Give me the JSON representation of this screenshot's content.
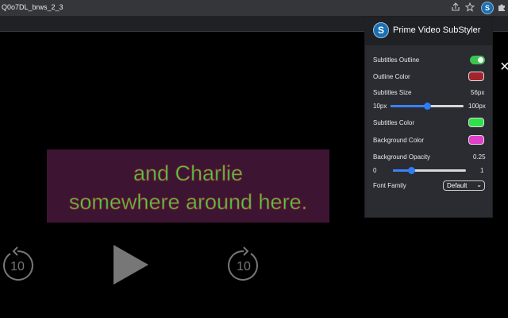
{
  "browser": {
    "tab_title": "Q0o7DL_brws_2_3",
    "icons": {
      "share": "share-icon",
      "bookmark": "star-icon",
      "extension": "subStyler-extension-icon",
      "puzzle": "puzzle-icon"
    },
    "extension_badge": "S"
  },
  "player": {
    "subtitle_lines": [
      "and Charlie",
      "somewhere around here."
    ],
    "rewind_label": "10",
    "forward_label": "10",
    "close_symbol": "×"
  },
  "popup": {
    "logo_letter": "S",
    "title": "Prime Video SubStyler",
    "subtitles_outline": {
      "label": "Subtitles Outline",
      "enabled": true
    },
    "outline_color": {
      "label": "Outline Color",
      "value": "#a3242c"
    },
    "subtitles_size": {
      "label": "Subtitles Size",
      "value": "56px",
      "min_label": "10px",
      "max_label": "100px",
      "level": 0.5
    },
    "subtitles_color": {
      "label": "Subtitles Color",
      "value": "#2ee04a"
    },
    "background_color": {
      "label": "Background Color",
      "value": "#e040c8"
    },
    "background_opacity": {
      "label": "Background Opacity",
      "value": "0.25",
      "min_label": "0",
      "max_label": "1",
      "level": 0.25
    },
    "font_family": {
      "label": "Font Family",
      "selected": "Default",
      "arrow": "⌄"
    }
  },
  "colors": {
    "subtitle_bg": "#3d1533",
    "accent_blue": "#2f7df6",
    "toggle_on": "#3dc34f"
  }
}
